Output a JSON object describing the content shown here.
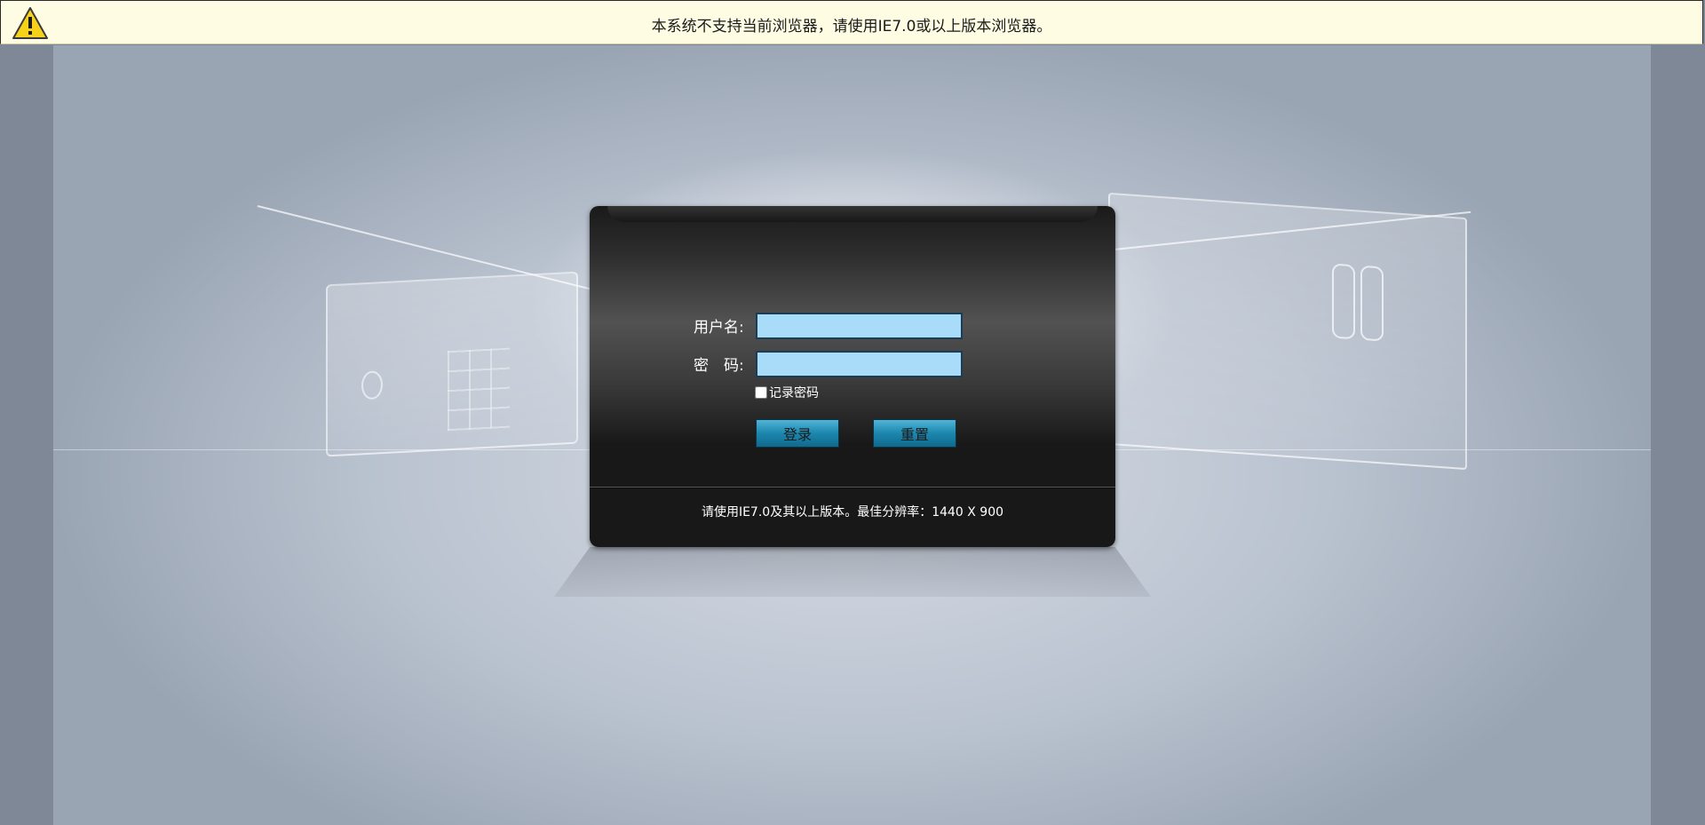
{
  "warning_bar": {
    "icon": "warning-triangle-icon",
    "message": "本系统不支持当前浏览器，请使用IE7.0或以上版本浏览器。"
  },
  "login_form": {
    "username_label": "用户名:",
    "password_label": "密　码:",
    "username_value": "",
    "password_value": "",
    "remember_label": "记录密码",
    "login_button": "登录",
    "reset_button": "重置",
    "footer_note": "请使用IE7.0及其以上版本。最佳分辨率：1440 X 900"
  },
  "colors": {
    "warning_background": "#fefde4",
    "input_background": "#a8dcf8",
    "button_accent": "#1d86ad"
  }
}
